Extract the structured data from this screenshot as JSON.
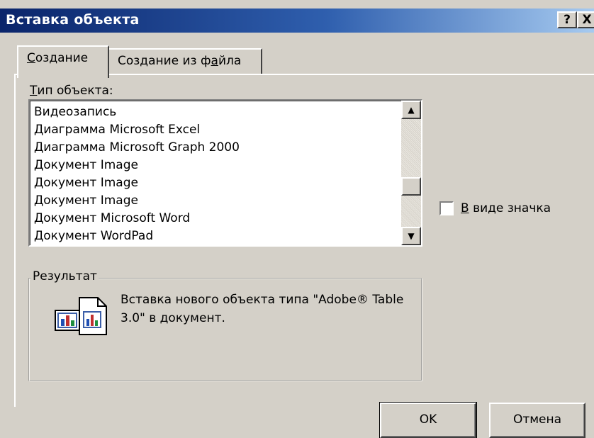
{
  "window": {
    "title": "Вставка объекта",
    "help_label": "?",
    "close_label": "X"
  },
  "tabs": [
    {
      "label": "Создание",
      "underline_char": "С",
      "rest": "оздание",
      "active": true
    },
    {
      "label": "Создание из файла",
      "pre": "Создание из ф",
      "underline_char": "а",
      "post": "йла",
      "active": false
    }
  ],
  "object_type": {
    "label": "Тип объекта:",
    "label_u": "Т",
    "label_rest": "ип объекта:",
    "items": [
      "Видеозапись",
      "Диаграмма Microsoft Excel",
      "Диаграмма Microsoft Graph 2000",
      "Документ Image",
      "Документ Image",
      "Документ Image",
      "Документ Microsoft Word",
      "Документ WordPad"
    ]
  },
  "display_as_icon": {
    "label": "В виде значка",
    "u": "В",
    "rest": " виде значка",
    "checked": false
  },
  "result": {
    "title": "Результат",
    "text": "Вставка нового объекта типа \"Adobe® Table 3.0\" в документ.",
    "icon": "chart-document-icon"
  },
  "buttons": {
    "ok": "OK",
    "cancel": "Отмена"
  },
  "colors": {
    "titlebar_start": "#0a246a",
    "titlebar_end": "#a6caf0",
    "face": "#d4d0c8"
  }
}
